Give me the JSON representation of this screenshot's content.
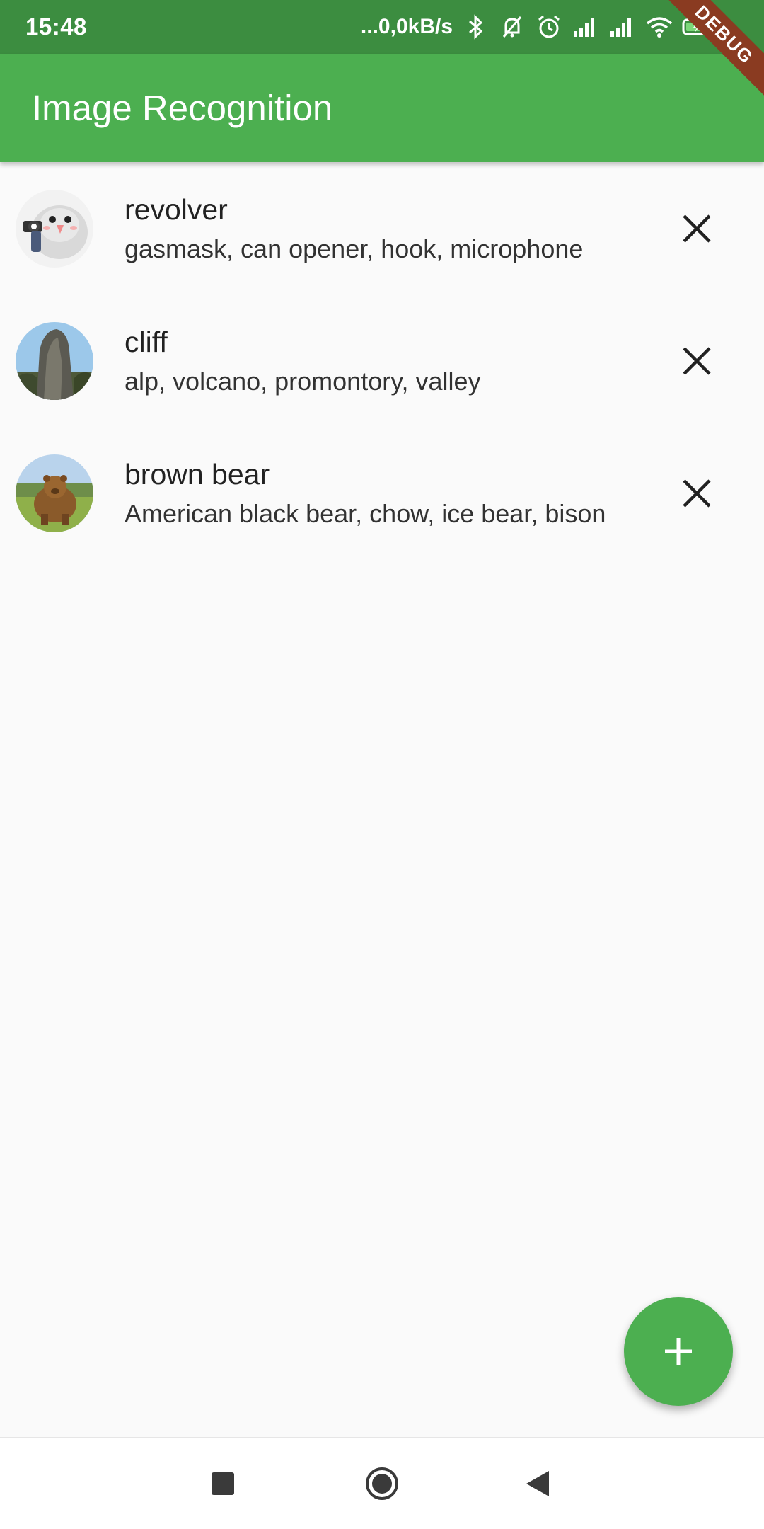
{
  "status_bar": {
    "time": "15:48",
    "network_speed": "...0,0kB/s",
    "icons": [
      "bluetooth-icon",
      "muted-bell-icon",
      "alarm-icon",
      "signal-icon",
      "signal-icon",
      "wifi-icon",
      "battery-charging-icon"
    ],
    "background_color": "#3c8d40"
  },
  "debug_banner": {
    "label": "DEBUG",
    "color": "#8a3b21"
  },
  "app_bar": {
    "title": "Image Recognition",
    "color": "#4caf50"
  },
  "items": [
    {
      "title": "revolver",
      "subtitle": "gasmask, can opener, hook, microphone",
      "thumbnail": "bird-with-gun-image",
      "delete_icon": "close-icon"
    },
    {
      "title": "cliff",
      "subtitle": "alp, volcano, promontory, valley",
      "thumbnail": "rock-cliff-image",
      "delete_icon": "close-icon"
    },
    {
      "title": "brown bear",
      "subtitle": "American black bear, chow, ice bear, bison",
      "thumbnail": "brown-bear-image",
      "delete_icon": "close-icon"
    }
  ],
  "fab": {
    "icon": "plus-icon",
    "color": "#4caf50"
  },
  "nav_bar": {
    "buttons": [
      "recents-square-icon",
      "home-circle-icon",
      "back-triangle-icon"
    ]
  }
}
